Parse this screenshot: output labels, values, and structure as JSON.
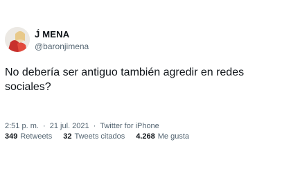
{
  "author": {
    "display_name": "J́ MENA",
    "handle": "@baronjimena"
  },
  "tweet": {
    "text": "No debería ser antiguo también agredir en redes sociales?"
  },
  "meta": {
    "time": "2:51 p. m.",
    "separator_1": "·",
    "date": "21 jul. 2021",
    "separator_2": "·",
    "source": "Twitter for iPhone"
  },
  "stats": {
    "retweets": {
      "count": "349",
      "label": "Retweets"
    },
    "quotes": {
      "count": "32",
      "label": "Tweets citados"
    },
    "likes": {
      "count": "4.268",
      "label": "Me gusta"
    }
  }
}
